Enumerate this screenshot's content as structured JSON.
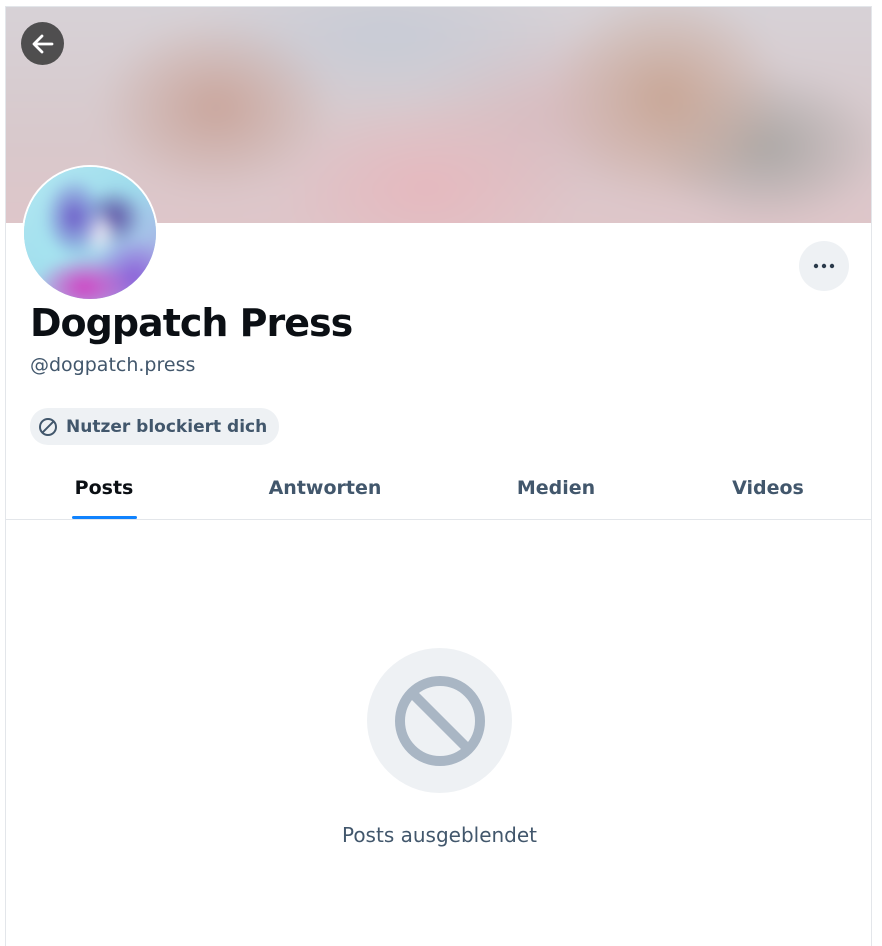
{
  "profile": {
    "display_name": "Dogpatch Press",
    "handle": "@dogpatch.press",
    "block_status": "Nutzer blockiert dich"
  },
  "icons": {
    "back": "arrow-left-icon",
    "more": "ellipsis-icon",
    "blocked": "block-circle-icon",
    "empty_state": "block-circle-icon"
  },
  "tabs": [
    {
      "label": "Posts",
      "active": true
    },
    {
      "label": "Antworten",
      "active": false
    },
    {
      "label": "Medien",
      "active": false
    },
    {
      "label": "Videos",
      "active": false
    }
  ],
  "empty_state": {
    "message": "Posts ausgeblendet"
  },
  "colors": {
    "accent": "#1083fe",
    "text_primary": "#0b0f14",
    "text_secondary": "#42576c",
    "pill_background": "#eef1f4",
    "empty_icon": "#a9b6c4"
  }
}
